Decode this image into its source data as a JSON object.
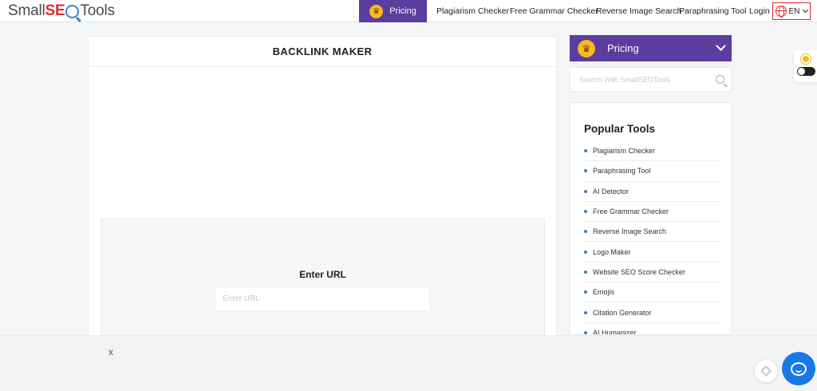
{
  "header": {
    "logo": {
      "part1": "Small",
      "seo": "SE",
      "part2": "Tools"
    },
    "pricing_label": "Pricing",
    "nav": [
      {
        "label": "Plagiarism Checker"
      },
      {
        "label": "Free Grammar Checker"
      },
      {
        "label": "Reverse Image Search"
      },
      {
        "label": "Paraphrasing Tool"
      },
      {
        "label": "Login"
      }
    ],
    "language": "EN"
  },
  "main": {
    "title": "BACKLINK MAKER",
    "url_label": "Enter URL",
    "url_placeholder": "Enter URL"
  },
  "sidebar": {
    "pricing_label": "Pricing",
    "search_placeholder": "Search With SmallSEOTools",
    "popular_title": "Popular Tools",
    "popular_items": [
      {
        "label": "Plagiarism Checker"
      },
      {
        "label": "Paraphrasing Tool"
      },
      {
        "label": "AI Detector"
      },
      {
        "label": "Free Grammar Checker"
      },
      {
        "label": "Reverse Image Search"
      },
      {
        "label": "Logo Maker"
      },
      {
        "label": "Website SEO Score Checker"
      },
      {
        "label": "Emojis"
      },
      {
        "label": "Citation Generator"
      },
      {
        "label": "AI Humanizer"
      }
    ]
  },
  "bottom": {
    "close_label": "x"
  },
  "colors": {
    "brand_purple": "#5b3c9f",
    "accent_red": "#e0282e",
    "chat_blue": "#1878e6",
    "crown_gold": "#f5b921"
  },
  "icons": [
    "crown-icon",
    "globe-icon",
    "chevron-down-icon",
    "search-icon",
    "sun-icon",
    "chat-icon",
    "scroll-top-icon"
  ]
}
